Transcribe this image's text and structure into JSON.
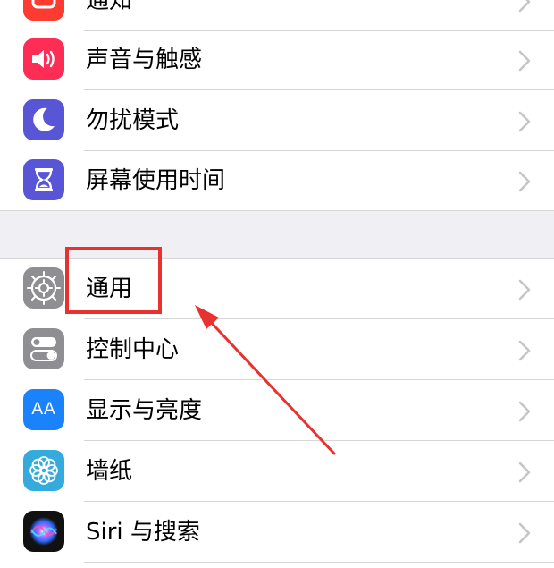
{
  "colors": {
    "notifications": "#fe3b30",
    "sounds": "#fe2d55",
    "dnd": "#5856d6",
    "screen_time": "#5856d6",
    "general": "#8e8e93",
    "control_center": "#8e8e93",
    "display": "#1a82fb",
    "wallpaper": "#35aadc",
    "highlight": "#e8322f",
    "separator": "#d6d6d9",
    "group_gap": "#efeff4"
  },
  "group1": [
    {
      "label": "通知",
      "icon": "notifications-icon"
    },
    {
      "label": "声音与触感",
      "icon": "speaker-icon"
    },
    {
      "label": "勿扰模式",
      "icon": "moon-icon"
    },
    {
      "label": "屏幕使用时间",
      "icon": "hourglass-icon"
    }
  ],
  "group2": [
    {
      "label": "通用",
      "icon": "gear-icon"
    },
    {
      "label": "控制中心",
      "icon": "toggles-icon"
    },
    {
      "label": "显示与亮度",
      "icon": "text-size-icon",
      "icon_text": "AA"
    },
    {
      "label": "墙纸",
      "icon": "flower-icon"
    },
    {
      "label": "Siri 与搜索",
      "icon": "siri-icon"
    }
  ],
  "annotation": {
    "target": "通用"
  }
}
